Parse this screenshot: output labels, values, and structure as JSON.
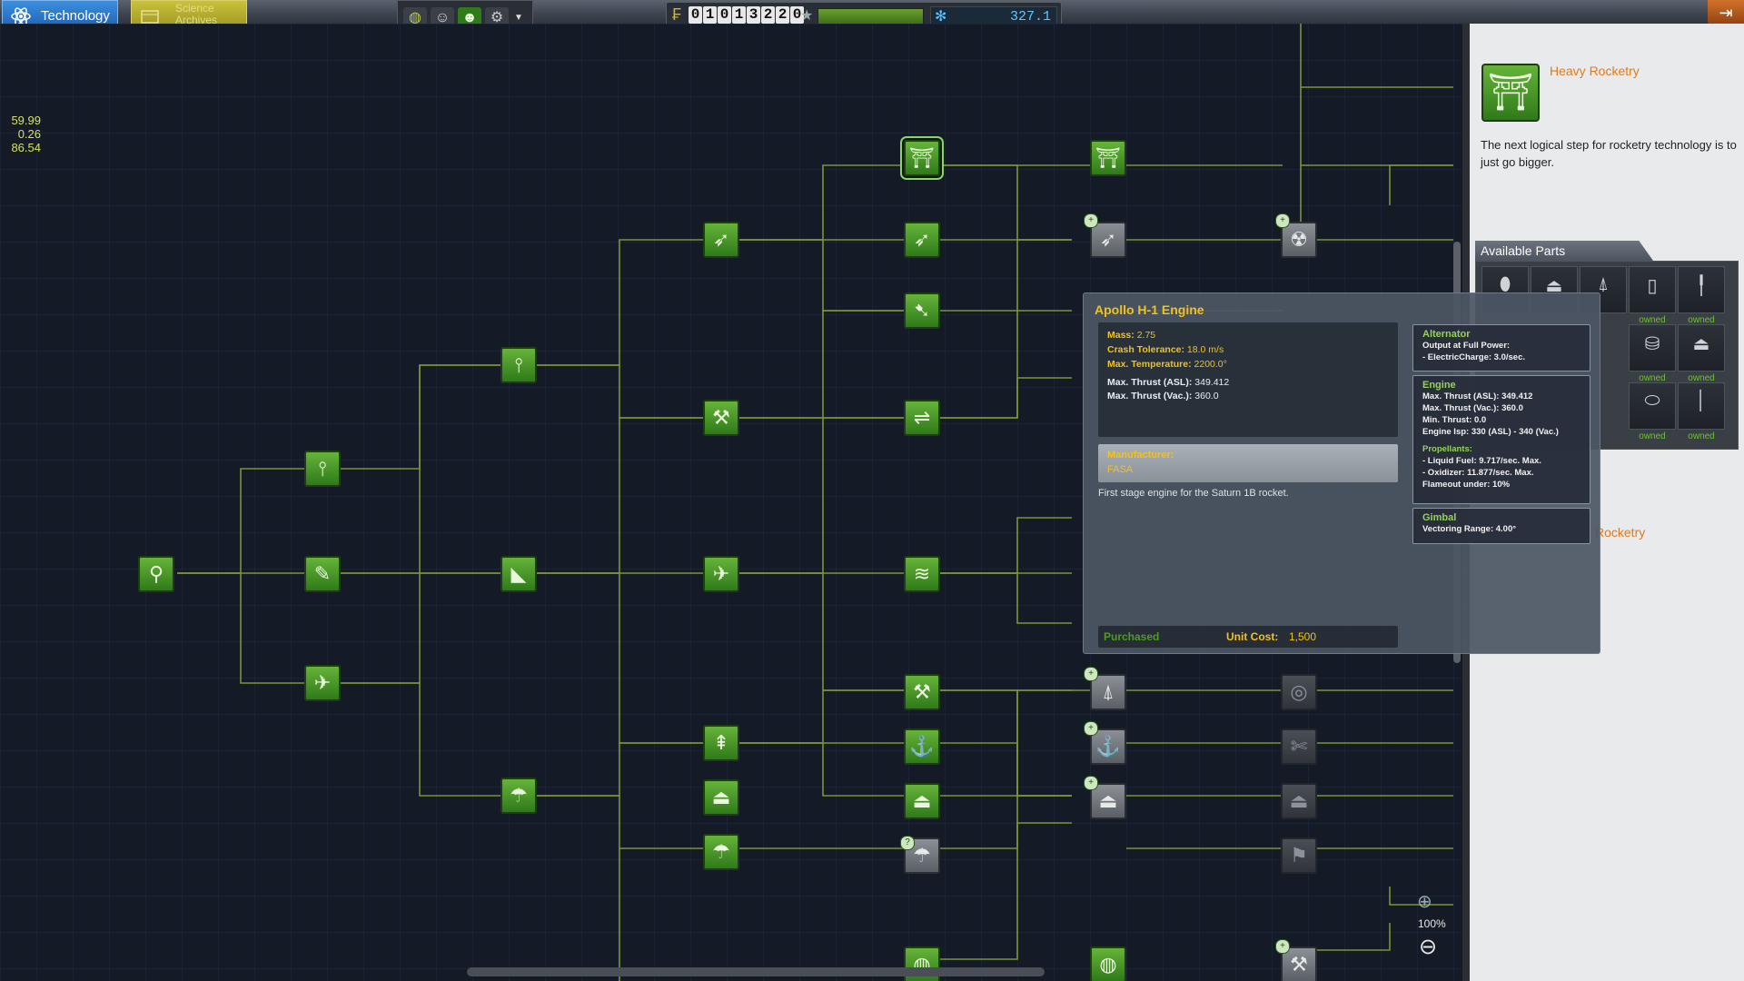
{
  "tabs": {
    "technology": "Technology",
    "science_archives": "Science Archives"
  },
  "toolbar": {
    "buttons": [
      "globe-icon",
      "sr-icon",
      "kerbal-icon",
      "settings-icon"
    ]
  },
  "funds": {
    "digits": [
      "0",
      "1",
      "0",
      "1",
      "3",
      "2",
      "2",
      "0"
    ]
  },
  "science": {
    "value": "327.1"
  },
  "debug": {
    "lines": [
      "59.99",
      "0.26",
      "86.54"
    ]
  },
  "right_panel": {
    "node_title": "Heavy Rocketry",
    "node_desc": "The next logical step for rocketry technology is to just go bigger.",
    "parts_header": "Available Parts",
    "parts": [
      {
        "icon": "capsule",
        "label": ""
      },
      {
        "icon": "engine",
        "label": ""
      },
      {
        "icon": "nozzle",
        "label": ""
      },
      {
        "icon": "tank",
        "label": "owned"
      },
      {
        "icon": "strut",
        "label": "owned"
      },
      {
        "icon": "part",
        "label": ""
      },
      {
        "icon": "part",
        "label": ""
      },
      {
        "icon": "part",
        "label": ""
      },
      {
        "icon": "fuel-tank",
        "label": "owned"
      },
      {
        "icon": "engine-bell",
        "label": "owned"
      },
      {
        "icon": "part",
        "label": ""
      },
      {
        "icon": "part",
        "label": ""
      },
      {
        "icon": "part",
        "label": ""
      },
      {
        "icon": "adapter",
        "label": "owned"
      },
      {
        "icon": "pole",
        "label": "owned"
      }
    ],
    "fragment": "Rocketry"
  },
  "tooltip": {
    "title": "Apollo H-1 Engine",
    "stats": [
      {
        "label": "Mass:",
        "value": "2.75",
        "style": "y"
      },
      {
        "label": "Crash Tolerance:",
        "value": "18.0 m/s",
        "style": "y"
      },
      {
        "label": "Max. Temperature:",
        "value": "2200.0°",
        "style": "y"
      },
      {
        "label": "Max. Thrust (ASL):",
        "value": "349.412",
        "style": "w"
      },
      {
        "label": "Max. Thrust (Vac.):",
        "value": "360.0",
        "style": "w"
      }
    ],
    "manufacturer_label": "Manufacturer:",
    "manufacturer": "FASA",
    "description": "First stage engine for the Saturn 1B rocket.",
    "status": "Purchased",
    "cost_label": "Unit Cost:",
    "cost_value": "1,500",
    "modules": [
      {
        "title": "Alternator",
        "lines": [
          "Output at Full Power:",
          "- ElectricCharge: 3.0/sec."
        ]
      },
      {
        "title": "Engine",
        "lines": [
          "Max. Thrust (ASL): 349.412",
          "Max. Thrust (Vac.): 360.0",
          "Min. Thrust: 0.0",
          "Engine Isp: 330 (ASL) - 340 (Vac.)"
        ],
        "sub_title": "Propellants:",
        "sub_lines": [
          "- Liquid Fuel: 9.717/sec. Max.",
          "- Oxidizer: 11.877/sec. Max.",
          "Flameout under: 10%"
        ]
      },
      {
        "title": "Gimbal",
        "lines": [
          "Vectoring Range: 4.00°"
        ]
      }
    ]
  },
  "zoom": {
    "level": "100%"
  },
  "tree_nodes": [
    {
      "id": "start",
      "icon": "⚲",
      "state": "green"
    },
    {
      "id": "basic-rocketry",
      "icon": "⫯",
      "state": "green"
    },
    {
      "id": "engineering-101",
      "icon": "✎",
      "state": "green"
    },
    {
      "id": "stability",
      "icon": "✈",
      "state": "green"
    },
    {
      "id": "general-rocketry",
      "icon": "⫯",
      "state": "green"
    },
    {
      "id": "aviation-basic",
      "icon": "◣",
      "state": "green"
    },
    {
      "id": "survivability",
      "icon": "☂",
      "state": "green"
    },
    {
      "id": "advanced-rocketry",
      "icon": "➶",
      "state": "green"
    },
    {
      "id": "general-construction",
      "icon": "⚒",
      "state": "green"
    },
    {
      "id": "aviation",
      "icon": "✈",
      "state": "green"
    },
    {
      "id": "landing",
      "icon": "⇞",
      "state": "green"
    },
    {
      "id": "science-tech",
      "icon": "⏏",
      "state": "green"
    },
    {
      "id": "flight-control",
      "icon": "☂",
      "state": "green"
    },
    {
      "id": "heavy-rocketry",
      "icon": "⛩",
      "state": "green",
      "selected": true
    },
    {
      "id": "fuel-systems",
      "icon": "➶",
      "state": "green"
    },
    {
      "id": "propulsion-systems",
      "icon": "➷",
      "state": "green"
    },
    {
      "id": "advanced-construction",
      "icon": "⇌",
      "state": "green"
    },
    {
      "id": "supersonic-flight",
      "icon": "≋",
      "state": "green"
    },
    {
      "id": "advanced-landing",
      "icon": "⚒",
      "state": "green"
    },
    {
      "id": "adv-flight-control",
      "icon": "⚓",
      "state": "green"
    },
    {
      "id": "advanced-exploration",
      "icon": "⏏",
      "state": "green"
    },
    {
      "id": "aerodynamics",
      "icon": "☂",
      "state": "gray"
    },
    {
      "id": "electrics",
      "icon": "◍",
      "state": "green"
    },
    {
      "id": "heavier-rocketry",
      "icon": "⛩",
      "state": "green"
    },
    {
      "id": "adv-fuel-systems",
      "icon": "➶",
      "state": "gray"
    },
    {
      "id": "nuclear-propulsion",
      "icon": "☢",
      "state": "gray"
    },
    {
      "id": "field-science",
      "icon": "⍋",
      "state": "gray"
    },
    {
      "id": "specialized-control",
      "icon": "⚓",
      "state": "gray"
    },
    {
      "id": "command-modules",
      "icon": "⏏",
      "state": "gray"
    },
    {
      "id": "advanced-electrics",
      "icon": "◍",
      "state": "green"
    },
    {
      "id": "composites",
      "icon": "◎",
      "state": "dim"
    },
    {
      "id": "adv-science-tech",
      "icon": "✄",
      "state": "dim"
    },
    {
      "id": "advanced-unmanned",
      "icon": "⏏",
      "state": "dim"
    },
    {
      "id": "heavy-landing",
      "icon": "⚑",
      "state": "dim"
    },
    {
      "id": "adv-metalworks",
      "icon": "⚒",
      "state": "gray"
    }
  ]
}
